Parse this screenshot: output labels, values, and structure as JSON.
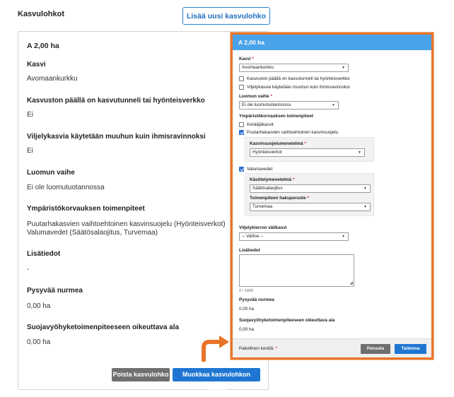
{
  "page": {
    "title": "Kasvulohkot",
    "add_button": "Lisää uusi kasvulohko"
  },
  "card": {
    "title": "A 2,00 ha",
    "fields": [
      {
        "label": "Kasvi",
        "value": "Avomaankurkku"
      },
      {
        "label": "Kasvuston päällä on kasvutunneli tai hyönteisverkko",
        "value": "Ei"
      },
      {
        "label": "Viljelykasvia käytetään muuhun kuin ihmisravinnoksi",
        "value": "Ei"
      },
      {
        "label": "Luomun vaihe",
        "value": "Ei ole luomutuotannossa"
      },
      {
        "label": "Ympäristökorvauksen toimenpiteet",
        "value": "Puutarhakasvien vaihtoehtoinen kasvinsuojelu  (Hyönteisverkot)",
        "value2": "Valumavedet  (Säätösalaojitus, Turvemaa)"
      },
      {
        "label": "Lisätiedot",
        "value": "-"
      },
      {
        "label": "Pysyvää nurmea",
        "value": "0,00 ha"
      },
      {
        "label": "Suojavyöhyketoimenpiteeseen oikeuttava ala",
        "value": "0,00 ha"
      }
    ],
    "delete_button": "Poista kasvulohko",
    "edit_button": "Muokkaa kasvulohkon tietoja"
  },
  "modal": {
    "title": "A 2,00 ha",
    "kasvi_label": "Kasvi",
    "kasvi_value": "Avomaankurkku",
    "chk_tunneli": "Kasvuston päällä on kasvutunneli tai hyönteisverkko",
    "chk_muuhun": "Viljelykasvia käytetään muuhun kuin ihmisravinnoksi",
    "luomu_label": "Luomun vaihe",
    "luomu_value": "Ei ole luomutuotannossa",
    "ymparisto_label": "Ympäristökorvauksen toimenpiteet",
    "chk_keraaja": "Kerääjäkasvit",
    "chk_puutarha": "Puutarhakasvien vaihtoehtoinen kasvinsuojelu",
    "kasvinsuojelu_label": "Kasvinsuojelumenetelmä",
    "kasvinsuojelu_value": "Hyönteisverkot",
    "chk_valuma": "Valumavedet",
    "kasittely_label": "Käsittelymenetelmä",
    "kasittely_value": "Säätösalaojitus",
    "hakuperuste_label": "Toimenpiteen hakuperuste",
    "hakuperuste_value": "Turvemaa",
    "valikasvi_label": "Viljelykierron välikasvi",
    "valikasvi_value": "-- Valitse --",
    "lisatiedot_label": "Lisätiedot",
    "char_count": "0 / 1000",
    "nurmi_label": "Pysyvää nurmea",
    "nurmi_value": "0,00 ha",
    "suoja_label": "Suojavyöhyketoimenpiteeseen oikeuttava ala",
    "suoja_value": "0,00 ha",
    "required_note": "Pakollinen kenttä:",
    "required_star": "*",
    "cancel_button": "Peruuta",
    "save_button": "Tallenna"
  },
  "colors": {
    "accent_orange": "#e8742a",
    "primary_blue": "#1f76d2",
    "header_blue": "#4aa3e8"
  }
}
